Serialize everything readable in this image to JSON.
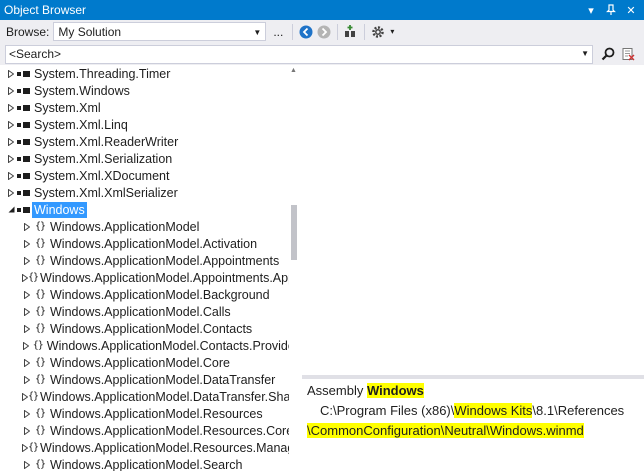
{
  "window": {
    "title": "Object Browser",
    "colors": {
      "titlebar": "#007acc",
      "selection": "#3399ff",
      "highlight": "#ffff00"
    }
  },
  "toolbar": {
    "browse_label": "Browse:",
    "browse_value": "My Solution",
    "ellipsis_label": "..."
  },
  "search": {
    "placeholder": "<Search>"
  },
  "tree": {
    "items": [
      {
        "label": "System.Threading.Timer",
        "icon": "assembly-icon",
        "level": 0,
        "expanded": false
      },
      {
        "label": "System.Windows",
        "icon": "assembly-icon",
        "level": 0,
        "expanded": false
      },
      {
        "label": "System.Xml",
        "icon": "assembly-icon",
        "level": 0,
        "expanded": false
      },
      {
        "label": "System.Xml.Linq",
        "icon": "assembly-icon",
        "level": 0,
        "expanded": false
      },
      {
        "label": "System.Xml.ReaderWriter",
        "icon": "assembly-icon",
        "level": 0,
        "expanded": false
      },
      {
        "label": "System.Xml.Serialization",
        "icon": "assembly-icon",
        "level": 0,
        "expanded": false
      },
      {
        "label": "System.Xml.XDocument",
        "icon": "assembly-icon",
        "level": 0,
        "expanded": false
      },
      {
        "label": "System.Xml.XmlSerializer",
        "icon": "assembly-icon",
        "level": 0,
        "expanded": false
      },
      {
        "label": "Windows",
        "icon": "assembly-icon",
        "level": 0,
        "expanded": true,
        "selected": true
      },
      {
        "label": "Windows.ApplicationModel",
        "icon": "namespace-icon",
        "level": 1
      },
      {
        "label": "Windows.ApplicationModel.Activation",
        "icon": "namespace-icon",
        "level": 1
      },
      {
        "label": "Windows.ApplicationModel.Appointments",
        "icon": "namespace-icon",
        "level": 1
      },
      {
        "label": "Windows.ApplicationModel.Appointments.Appoi",
        "icon": "namespace-icon",
        "level": 1
      },
      {
        "label": "Windows.ApplicationModel.Background",
        "icon": "namespace-icon",
        "level": 1
      },
      {
        "label": "Windows.ApplicationModel.Calls",
        "icon": "namespace-icon",
        "level": 1
      },
      {
        "label": "Windows.ApplicationModel.Contacts",
        "icon": "namespace-icon",
        "level": 1
      },
      {
        "label": "Windows.ApplicationModel.Contacts.Provider",
        "icon": "namespace-icon",
        "level": 1
      },
      {
        "label": "Windows.ApplicationModel.Core",
        "icon": "namespace-icon",
        "level": 1
      },
      {
        "label": "Windows.ApplicationModel.DataTransfer",
        "icon": "namespace-icon",
        "level": 1
      },
      {
        "label": "Windows.ApplicationModel.DataTransfer.ShareT",
        "icon": "namespace-icon",
        "level": 1
      },
      {
        "label": "Windows.ApplicationModel.Resources",
        "icon": "namespace-icon",
        "level": 1
      },
      {
        "label": "Windows.ApplicationModel.Resources.Core",
        "icon": "namespace-icon",
        "level": 1
      },
      {
        "label": "Windows.ApplicationModel.Resources.Manager",
        "icon": "namespace-icon",
        "level": 1
      },
      {
        "label": "Windows.ApplicationModel.Search",
        "icon": "namespace-icon",
        "level": 1
      }
    ]
  },
  "details": {
    "assembly_prefix": "Assembly ",
    "assembly_name": "Windows",
    "path_start": "C:\\Program Files (x86)\\",
    "path_kits": "Windows Kits",
    "path_mid": "\\8.1\\References",
    "path_sep1": "\\",
    "path_common": "CommonConfiguration",
    "path_sep2": "\\",
    "path_neutral": "Neutral",
    "path_sep3": "\\",
    "path_file": "Windows.winmd"
  }
}
